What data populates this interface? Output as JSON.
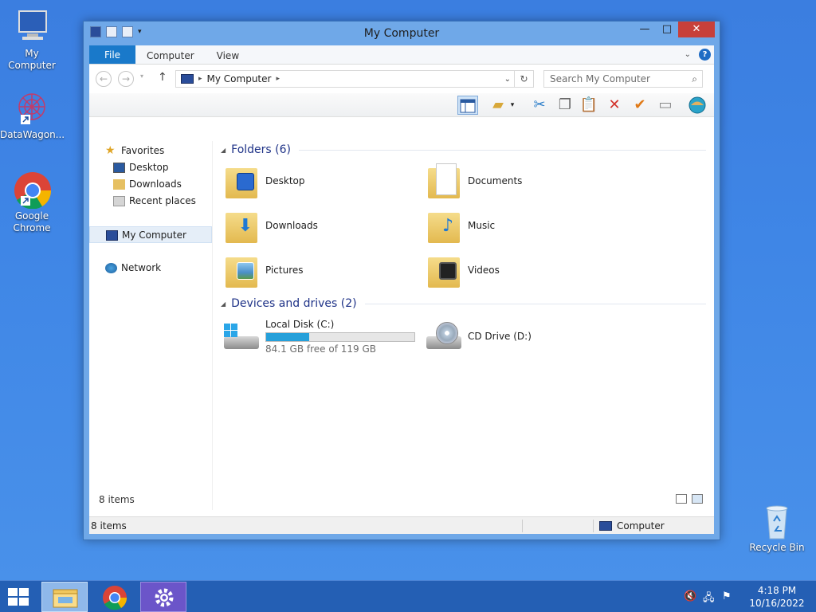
{
  "desktop": {
    "icons": [
      {
        "label": "My Computer"
      },
      {
        "label": "DataWagon..."
      },
      {
        "label": "Google Chrome"
      },
      {
        "label": "Recycle Bin"
      }
    ]
  },
  "window": {
    "title": "My Computer",
    "controls": {
      "minimize": "—",
      "maximize": "□",
      "close": "✕"
    },
    "ribbon": {
      "file_tab": "File",
      "tabs": [
        "Computer",
        "View"
      ],
      "help": "?"
    },
    "address": {
      "path": "My Computer",
      "search_placeholder": "Search My Computer"
    },
    "nav_pane": {
      "favorites": "Favorites",
      "favorites_items": [
        "Desktop",
        "Downloads",
        "Recent places"
      ],
      "this_pc": "My Computer",
      "network": "Network"
    },
    "content": {
      "folders_header": "Folders (6)",
      "folders": [
        "Desktop",
        "Documents",
        "Downloads",
        "Music",
        "Pictures",
        "Videos"
      ],
      "drives_header": "Devices and drives (2)",
      "drives": [
        {
          "name": "Local Disk (C:)",
          "free_text": "84.1 GB free of 119 GB",
          "used_fraction": 0.29
        },
        {
          "name": "CD Drive (D:)"
        }
      ]
    },
    "status_inner": "8 items",
    "statusbar": {
      "left": "8 items",
      "right": "Computer"
    }
  },
  "taskbar": {
    "time": "4:18 PM",
    "date": "10/16/2022"
  },
  "colors": {
    "accent": "#1979ca",
    "progress": "#26a0da",
    "desktop": "#3f86e6",
    "taskbar": "#245fb4"
  }
}
